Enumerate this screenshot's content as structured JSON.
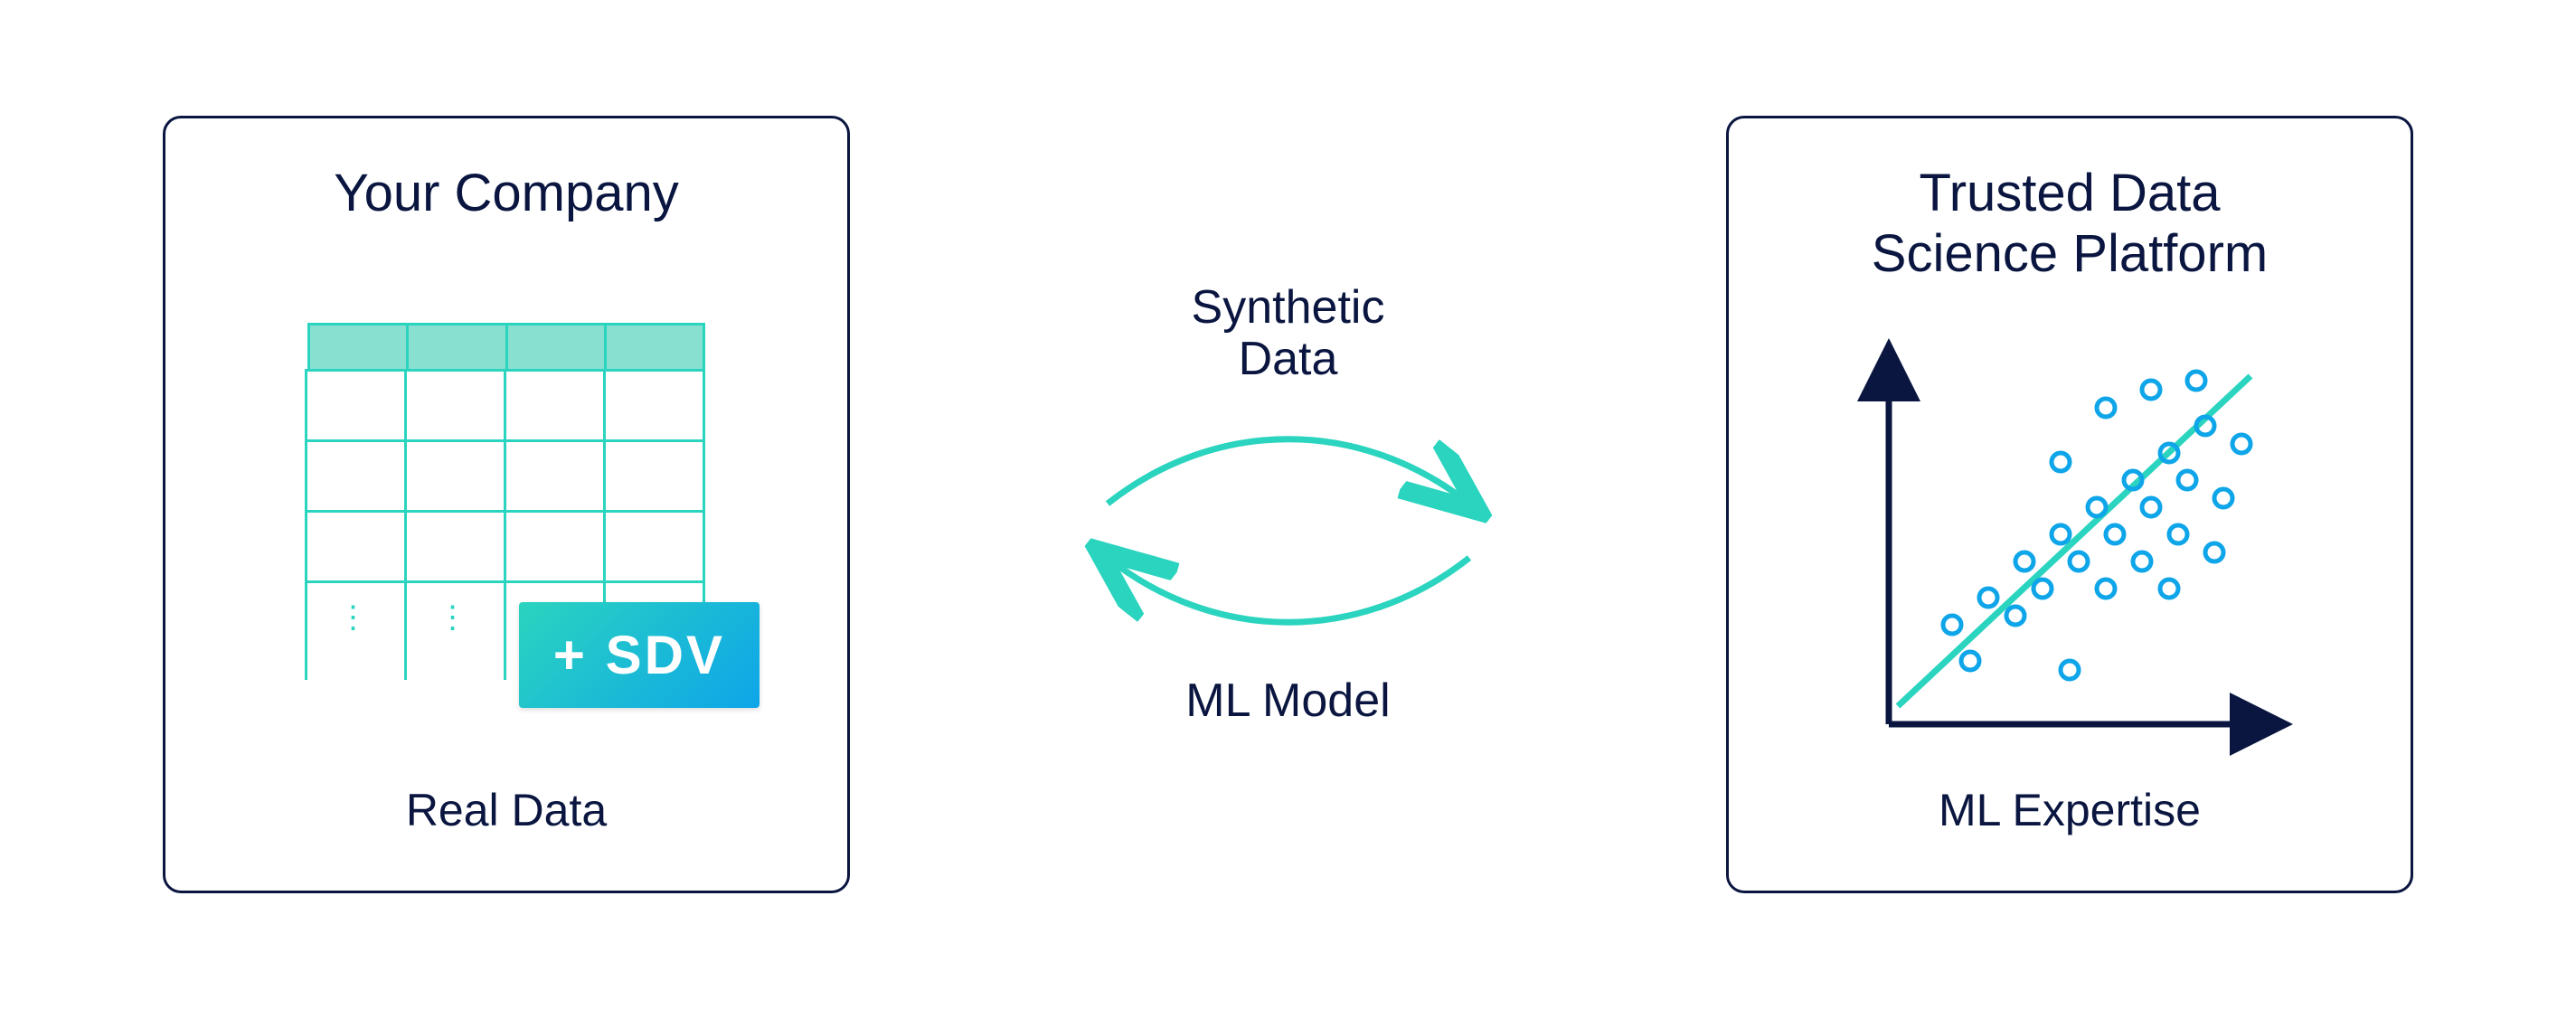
{
  "left": {
    "title": "Your Company",
    "caption": "Real Data",
    "badge": "+ SDV"
  },
  "middle": {
    "top": "Synthetic\nData",
    "bottom": "ML Model"
  },
  "right": {
    "title": "Trusted Data\nScience Platform",
    "caption": "ML Expertise"
  },
  "colors": {
    "ink": "#0a1640",
    "teal": "#2ad4bf",
    "blue": "#0ea5e9"
  }
}
